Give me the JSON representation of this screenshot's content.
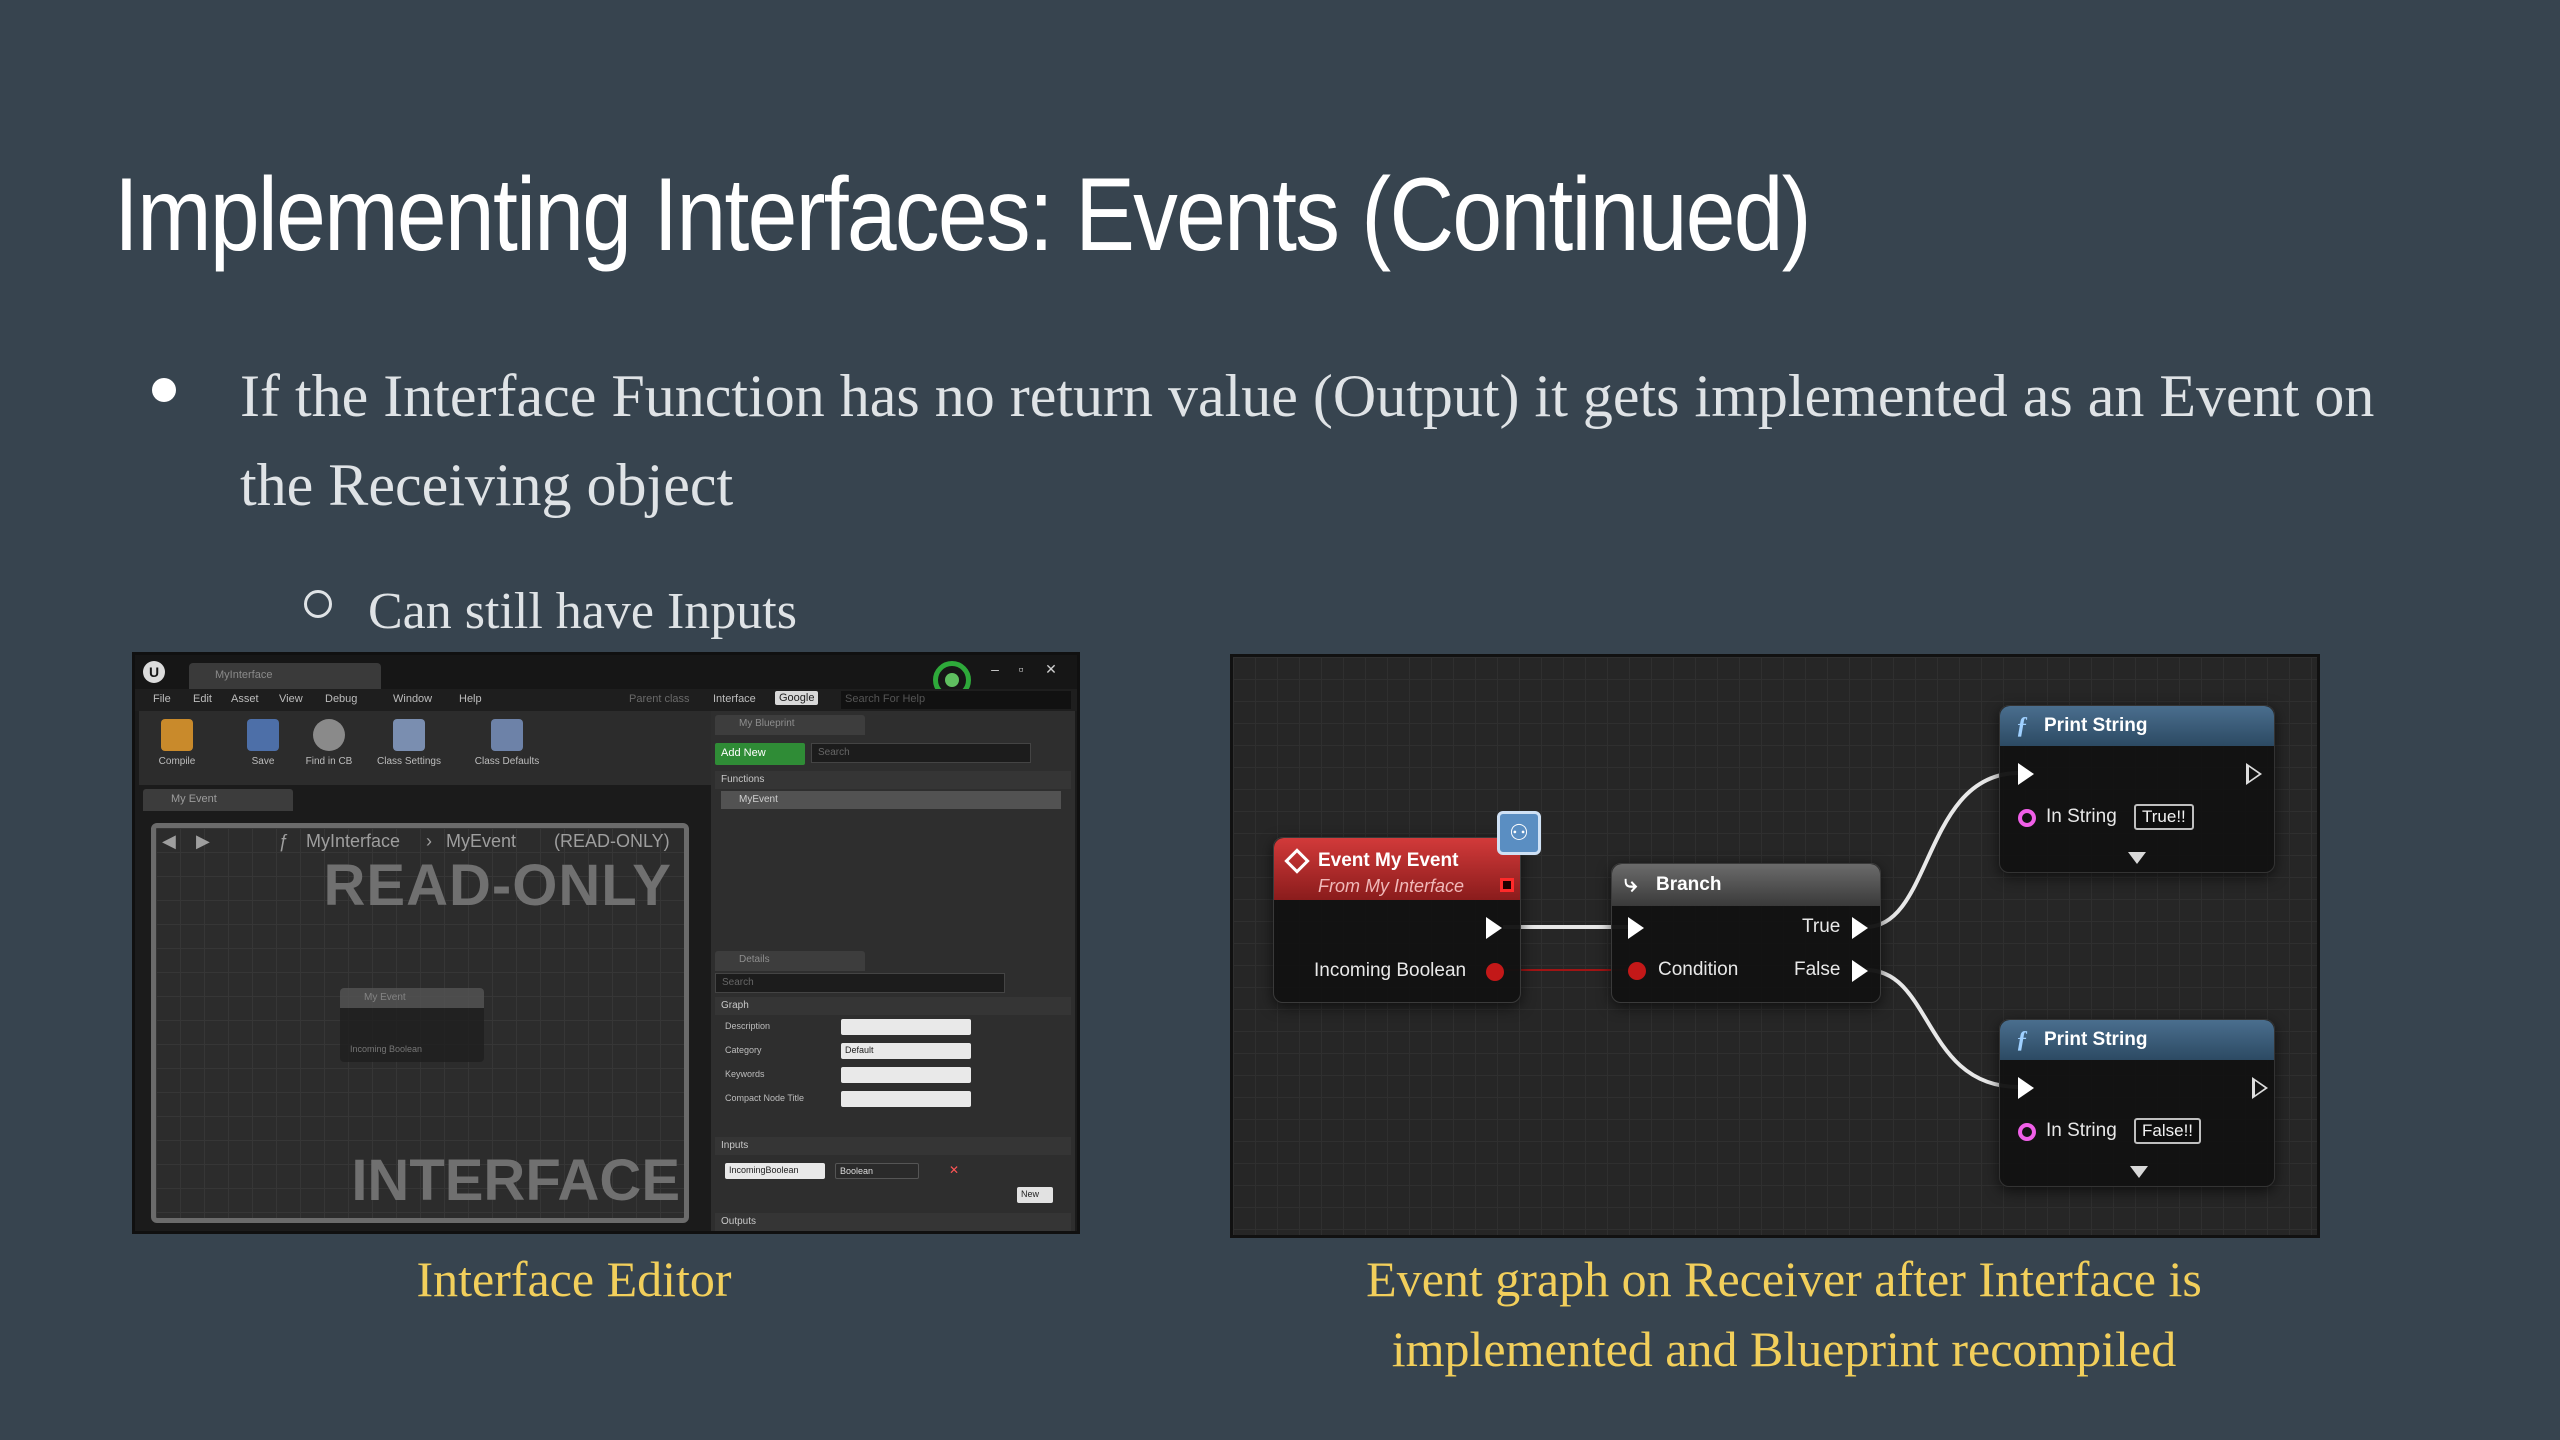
{
  "slide": {
    "title": "Implementing Interfaces: Events (Continued)",
    "bullet": "If the Interface Function has no return value (Output) it gets implemented as an Event on the Receiving object",
    "sub_bullet": "Can still have Inputs",
    "caption_left": "Interface Editor",
    "caption_right": "Event graph on Receiver after Interface is implemented and Blueprint recompiled"
  },
  "interface_editor": {
    "tab": "MyInterface",
    "menu": [
      "File",
      "Edit",
      "Asset",
      "View",
      "Debug",
      "Window",
      "Help"
    ],
    "parent_class_label": "Parent class",
    "parent_class_value": "Interface",
    "google_btn": "Google",
    "help_search_placeholder": "Search For Help",
    "toolbar": [
      "Compile",
      "Save",
      "Find in CB",
      "Class Settings",
      "Class Defaults"
    ],
    "graph_tab": "My Event",
    "breadcrumb_root": "MyInterface",
    "breadcrumb_sep": "›",
    "breadcrumb_leaf": "MyEvent",
    "breadcrumb_note": "(READ-ONLY)",
    "read_only_watermark": "READ-ONLY",
    "interface_watermark": "INTERFACE",
    "mini_node_title": "My Event",
    "mini_node_pin": "Incoming Boolean",
    "mybp_tab": "My Blueprint",
    "add_new": "Add New",
    "search_placeholder": "Search",
    "functions_header": "Functions",
    "function_item": "MyEvent",
    "details_tab": "Details",
    "graph_header": "Graph",
    "props": [
      {
        "label": "Description",
        "value": ""
      },
      {
        "label": "Category",
        "value": "Default"
      },
      {
        "label": "Keywords",
        "value": ""
      },
      {
        "label": "Compact Node Title",
        "value": ""
      }
    ],
    "inputs_header": "Inputs",
    "input_name": "IncomingBoolean",
    "input_type": "Boolean",
    "new_btn": "New",
    "outputs_header": "Outputs"
  },
  "event_graph": {
    "event_node": {
      "title": "Event My Event",
      "subtitle": "From My Interface",
      "pin": "Incoming Boolean"
    },
    "branch_node": {
      "title": "Branch",
      "condition": "Condition",
      "true": "True",
      "false": "False"
    },
    "print_true": {
      "title": "Print String",
      "pin": "In String",
      "value": "True!!"
    },
    "print_false": {
      "title": "Print String",
      "pin": "In String",
      "value": "False!!"
    },
    "colors": {
      "event_header": "#c62f2f",
      "bool_pin": "#c31818",
      "string_pin": "#f05fe8",
      "function_header": "#3d5d7a"
    }
  }
}
